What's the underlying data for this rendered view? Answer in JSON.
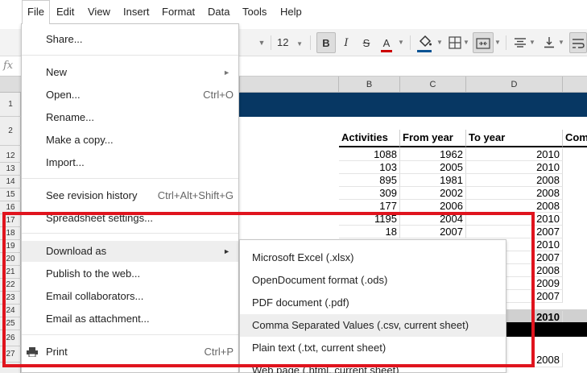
{
  "menubar": {
    "items": [
      "File",
      "Edit",
      "View",
      "Insert",
      "Format",
      "Data",
      "Tools",
      "Help"
    ]
  },
  "toolbar": {
    "font_size": "12",
    "bold_label": "B",
    "italic_label": "I",
    "strike_label": "S",
    "text_color_label": "A"
  },
  "formula": {
    "fx": "fx"
  },
  "grid": {
    "columns": [
      "B",
      "C",
      "D"
    ],
    "header_row_labels": [
      "Activities",
      "From year",
      "To year",
      "Com"
    ],
    "row_numbers": [
      "1",
      "2",
      "12",
      "13",
      "14",
      "15",
      "16",
      "17",
      "18",
      "19",
      "20",
      "21",
      "22",
      "23",
      "24",
      "25",
      "26",
      "27"
    ],
    "rows": [
      {
        "b": "1088",
        "c": "1962",
        "d": "2010"
      },
      {
        "b": "103",
        "c": "2005",
        "d": "2010"
      },
      {
        "b": "895",
        "c": "1981",
        "d": "2008"
      },
      {
        "b": "309",
        "c": "2002",
        "d": "2008"
      },
      {
        "b": "177",
        "c": "2006",
        "d": "2008"
      },
      {
        "b": "1195",
        "c": "2004",
        "d": "2010"
      },
      {
        "b": "18",
        "c": "2007",
        "d": "2007"
      },
      {
        "b": "",
        "c": "",
        "d": "2010"
      },
      {
        "b": "",
        "c": "",
        "d": "2007"
      },
      {
        "b": "",
        "c": "",
        "d": "2008"
      },
      {
        "b": "",
        "c": "",
        "d": "2009"
      },
      {
        "b": "",
        "c": "",
        "d": "2007"
      },
      {
        "b": "",
        "c": "",
        "d": "2010"
      },
      {
        "b": "",
        "c": "",
        "d": "2008"
      }
    ]
  },
  "file_menu": {
    "share": "Share...",
    "new": "New",
    "open": "Open...",
    "open_shortcut": "Ctrl+O",
    "rename": "Rename...",
    "make_copy": "Make a copy...",
    "import": "Import...",
    "revision_history": "See revision history",
    "revision_shortcut": "Ctrl+Alt+Shift+G",
    "spreadsheet_settings": "Spreadsheet settings...",
    "download_as": "Download as",
    "publish": "Publish to the web...",
    "email_collaborators": "Email collaborators...",
    "email_attachment": "Email as attachment...",
    "print": "Print",
    "print_shortcut": "Ctrl+P"
  },
  "download_submenu": {
    "items": [
      "Microsoft Excel (.xlsx)",
      "OpenDocument format (.ods)",
      "PDF document (.pdf)",
      "Comma Separated Values (.csv, current sheet)",
      "Plain text (.txt, current sheet)",
      "Web page (.html, current sheet)"
    ]
  },
  "colors": {
    "title_band": "#073763",
    "annotation": "#e0141e",
    "text_color_underline": "#cc0000",
    "fill_color_underline": "#0b5394"
  }
}
